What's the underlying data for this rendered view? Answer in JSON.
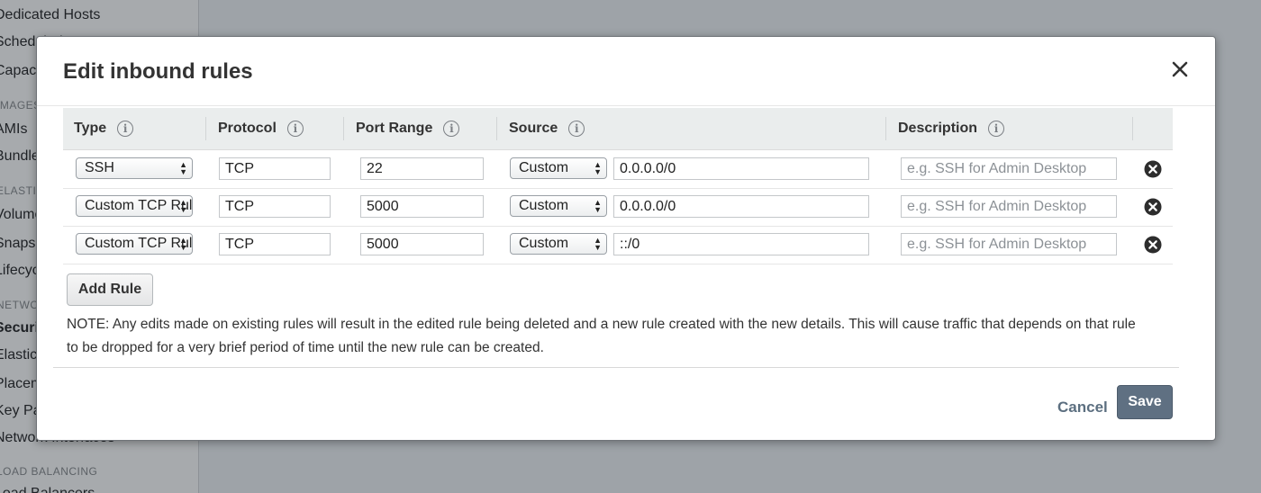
{
  "sidebar": {
    "items": [
      {
        "label": "Dedicated Hosts",
        "type": "item"
      },
      {
        "label": "Scheduled Instances",
        "type": "item"
      },
      {
        "label": "Capacity Reservations",
        "type": "item"
      },
      {
        "label": "IMAGES",
        "type": "heading"
      },
      {
        "label": "AMIs",
        "type": "item"
      },
      {
        "label": "Bundle Tasks",
        "type": "item"
      },
      {
        "label": "ELASTIC BLOCK STORE",
        "type": "heading"
      },
      {
        "label": "Volumes",
        "type": "item"
      },
      {
        "label": "Snapshots",
        "type": "item"
      },
      {
        "label": "Lifecycle Manager",
        "type": "item"
      },
      {
        "label": "NETWORK & SECURITY",
        "type": "heading"
      },
      {
        "label": "Security Groups",
        "type": "item"
      },
      {
        "label": "Elastic IPs",
        "type": "item"
      },
      {
        "label": "Placement Groups",
        "type": "item"
      },
      {
        "label": "Key Pairs",
        "type": "item"
      },
      {
        "label": "Network Interfaces",
        "type": "item"
      },
      {
        "label": "LOAD BALANCING",
        "type": "heading"
      },
      {
        "label": "Load Balancers",
        "type": "item"
      }
    ]
  },
  "modal": {
    "title": "Edit inbound rules",
    "columns": {
      "type": "Type",
      "protocol": "Protocol",
      "port_range": "Port Range",
      "source": "Source",
      "description": "Description"
    },
    "info_glyph": "i",
    "rules": [
      {
        "type": "SSH",
        "protocol": "TCP",
        "port_range": "22",
        "source_type": "Custom",
        "source": "0.0.0.0/0",
        "description_placeholder": "e.g. SSH for Admin Desktop"
      },
      {
        "type": "Custom TCP Rule",
        "protocol": "TCP",
        "port_range": "5000",
        "source_type": "Custom",
        "source": "0.0.0.0/0",
        "description_placeholder": "e.g. SSH for Admin Desktop"
      },
      {
        "type": "Custom TCP Rule",
        "protocol": "TCP",
        "port_range": "5000",
        "source_type": "Custom",
        "source": "::/0",
        "description_placeholder": "e.g. SSH for Admin Desktop"
      }
    ],
    "add_rule_label": "Add Rule",
    "note": "NOTE: Any edits made on existing rules will result in the edited rule being deleted and a new rule created with the new details. This will cause traffic that depends on that rule to be dropped for a very brief period of time until the new rule can be created.",
    "cancel_label": "Cancel",
    "save_label": "Save"
  },
  "colors": {
    "save_button": "#5f7082",
    "cancel_link": "#5c6f80",
    "header_bg": "#eaeded",
    "overlay": "#9ea3a8"
  },
  "icons": {
    "close": "close-icon",
    "info": "info-icon",
    "delete": "remove-circle-icon",
    "select": "select-arrows-icon"
  }
}
